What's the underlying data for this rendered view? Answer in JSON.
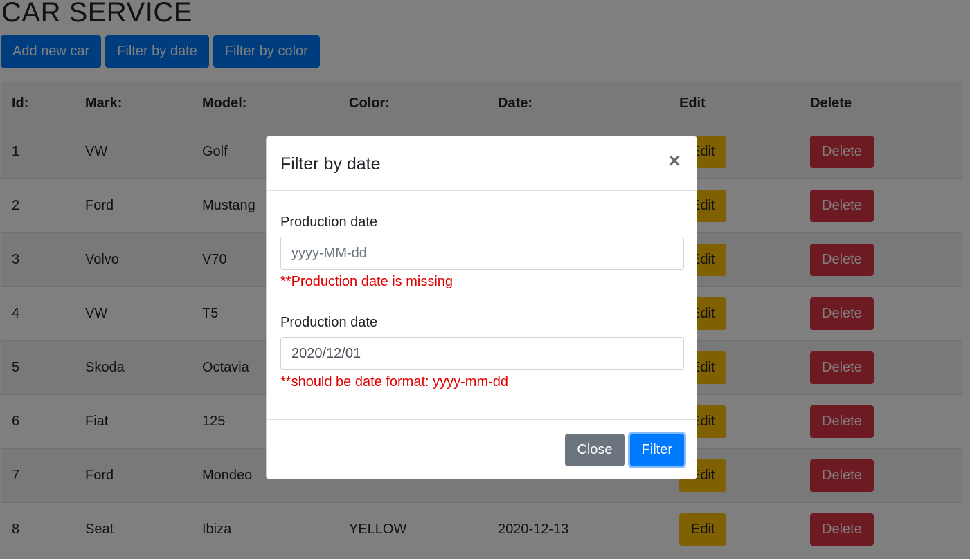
{
  "app": {
    "title": "CAR SERVICE"
  },
  "toolbar": {
    "add_label": "Add new car",
    "filter_date_label": "Filter by date",
    "filter_color_label": "Filter by color"
  },
  "table": {
    "headers": {
      "id": "Id:",
      "mark": "Mark:",
      "model": "Model:",
      "color": "Color:",
      "date": "Date:",
      "edit": "Edit",
      "delete": "Delete"
    },
    "rows": [
      {
        "id": "1",
        "mark": "VW",
        "model": "Golf",
        "color": "",
        "date": "",
        "edit": "Edit",
        "delete": "Delete"
      },
      {
        "id": "2",
        "mark": "Ford",
        "model": "Mustang",
        "color": "",
        "date": "",
        "edit": "Edit",
        "delete": "Delete"
      },
      {
        "id": "3",
        "mark": "Volvo",
        "model": "V70",
        "color": "",
        "date": "",
        "edit": "Edit",
        "delete": "Delete"
      },
      {
        "id": "4",
        "mark": "VW",
        "model": "T5",
        "color": "",
        "date": "",
        "edit": "Edit",
        "delete": "Delete"
      },
      {
        "id": "5",
        "mark": "Skoda",
        "model": "Octavia",
        "color": "",
        "date": "",
        "edit": "Edit",
        "delete": "Delete"
      },
      {
        "id": "6",
        "mark": "Fiat",
        "model": "125",
        "color": "",
        "date": "",
        "edit": "Edit",
        "delete": "Delete"
      },
      {
        "id": "7",
        "mark": "Ford",
        "model": "Mondeo",
        "color": "",
        "date": "",
        "edit": "Edit",
        "delete": "Delete"
      },
      {
        "id": "8",
        "mark": "Seat",
        "model": "Ibiza",
        "color": "YELLOW",
        "date": "2020-12-13",
        "edit": "Edit",
        "delete": "Delete"
      }
    ]
  },
  "modal": {
    "title": "Filter by date",
    "close_icon": "close-icon",
    "fields": [
      {
        "label": "Production date",
        "value": "",
        "placeholder": "yyyy-MM-dd",
        "error": "**Production date is missing"
      },
      {
        "label": "Production date",
        "value": "2020/12/01",
        "placeholder": "",
        "error": "**should be date format: yyyy-mm-dd"
      }
    ],
    "close_label": "Close",
    "filter_label": "Filter"
  },
  "colors": {
    "primary": "#007bff",
    "warning": "#ffc107",
    "danger": "#dc3545",
    "secondary": "#6c757d",
    "error": "#e00000"
  }
}
